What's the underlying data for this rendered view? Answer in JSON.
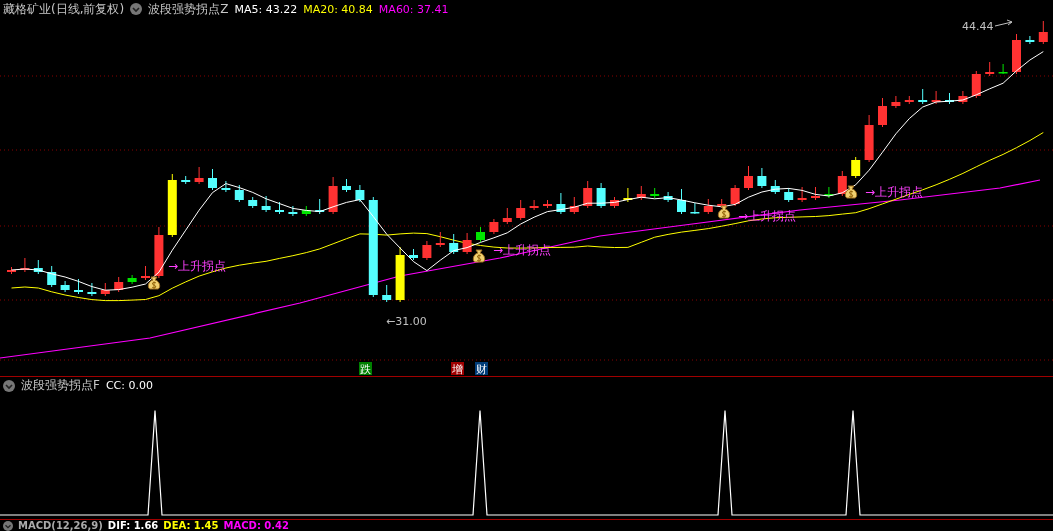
{
  "header": {
    "title": "藏格矿业(日线,前复权)",
    "indicator": "波段强势拐点Z",
    "readings": [
      {
        "label": "MA5: 43.22",
        "color": "#ffffff"
      },
      {
        "label": "MA20: 40.84",
        "color": "#ffff00"
      },
      {
        "label": "MA60: 37.41",
        "color": "#ff00ff"
      }
    ]
  },
  "price_chart": {
    "high_label": "44.44",
    "low_label": "←31.00",
    "signals": [
      {
        "label": "→上升拐点"
      },
      {
        "label": "→上升拐点"
      },
      {
        "label": "→上升拐点"
      },
      {
        "label": "→上升拐点"
      }
    ],
    "markers": [
      {
        "text": "跌",
        "color": "#008000"
      },
      {
        "text": "增",
        "color": "#a00000"
      },
      {
        "text": "财",
        "color": "#003c78"
      }
    ]
  },
  "indicator_panel": {
    "name": "波段强势拐点F",
    "reading": "CC: 0.00"
  },
  "macd_bar": {
    "name": "MACD(12,26,9)",
    "readings": [
      {
        "label": "DIF: 1.66",
        "color": "#ffffff"
      },
      {
        "label": "DEA: 1.45",
        "color": "#ffff00"
      },
      {
        "label": "MACD: 0.42",
        "color": "#ff00ff"
      }
    ]
  }
}
